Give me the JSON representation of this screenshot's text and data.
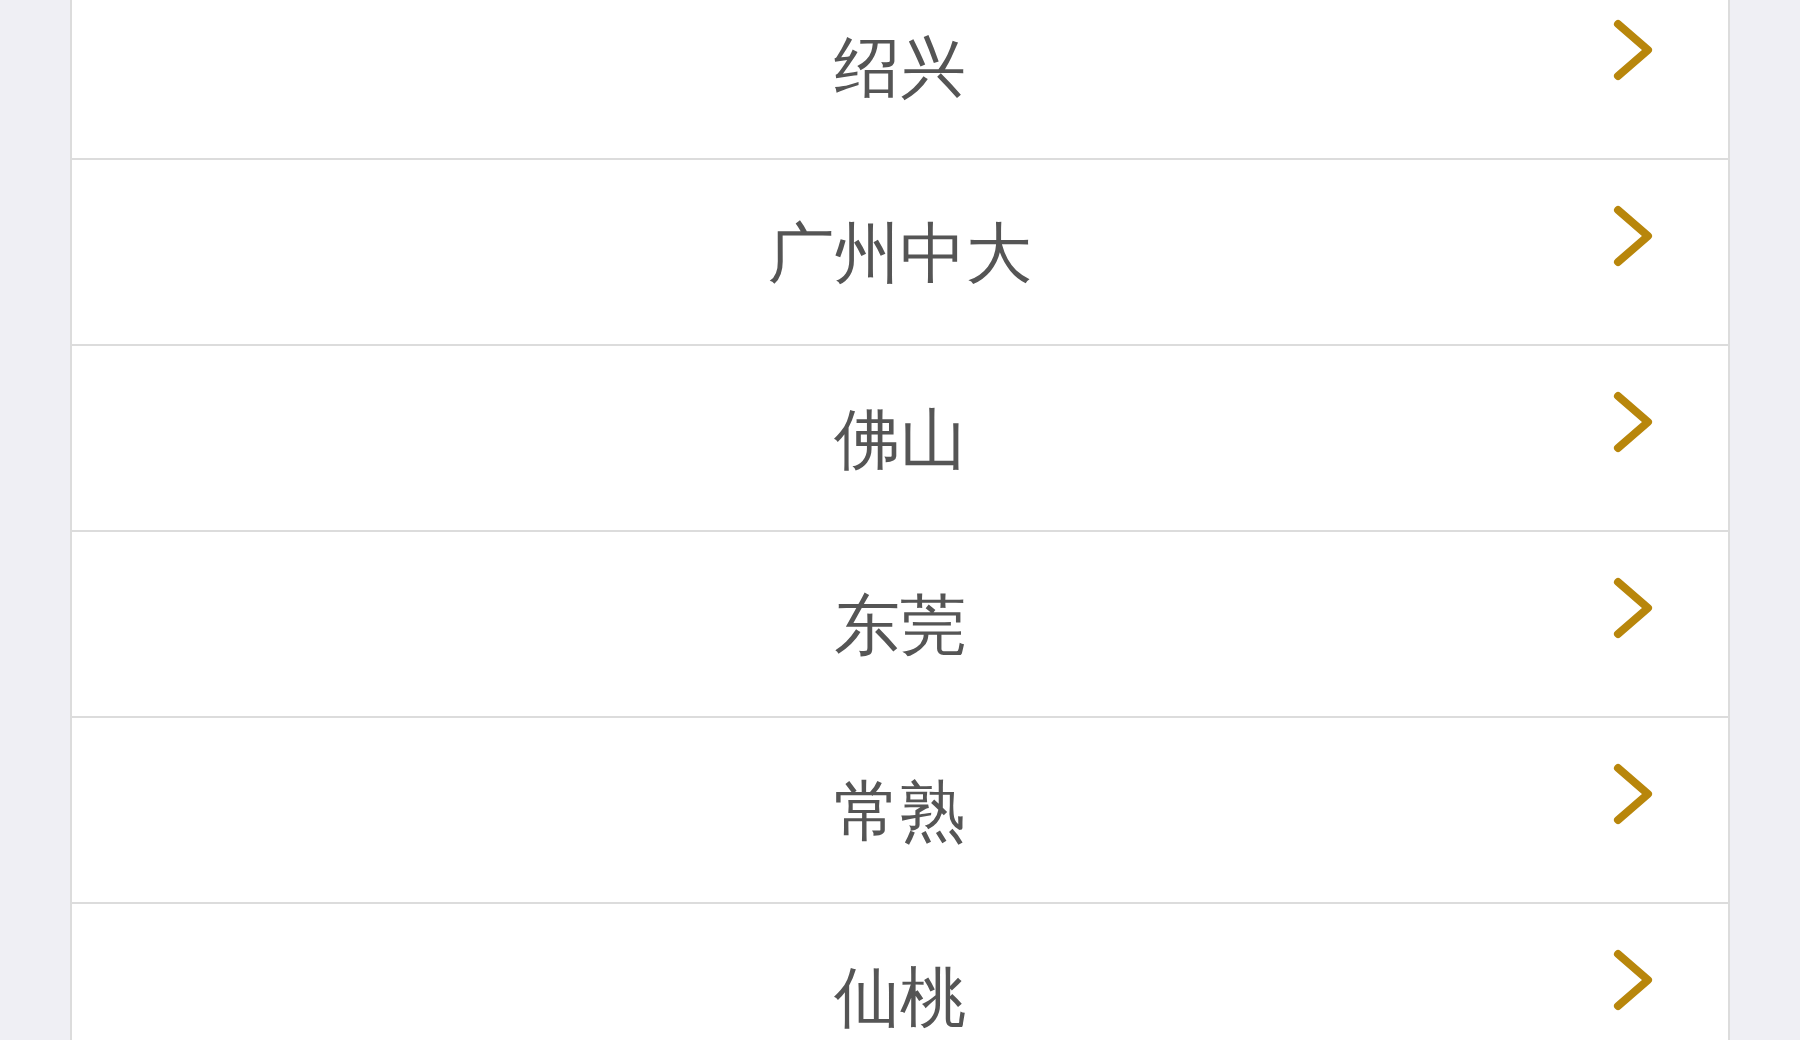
{
  "cities": [
    {
      "label": "绍兴"
    },
    {
      "label": "广州中大"
    },
    {
      "label": "佛山"
    },
    {
      "label": "东莞"
    },
    {
      "label": "常熟"
    },
    {
      "label": "仙桃"
    }
  ]
}
